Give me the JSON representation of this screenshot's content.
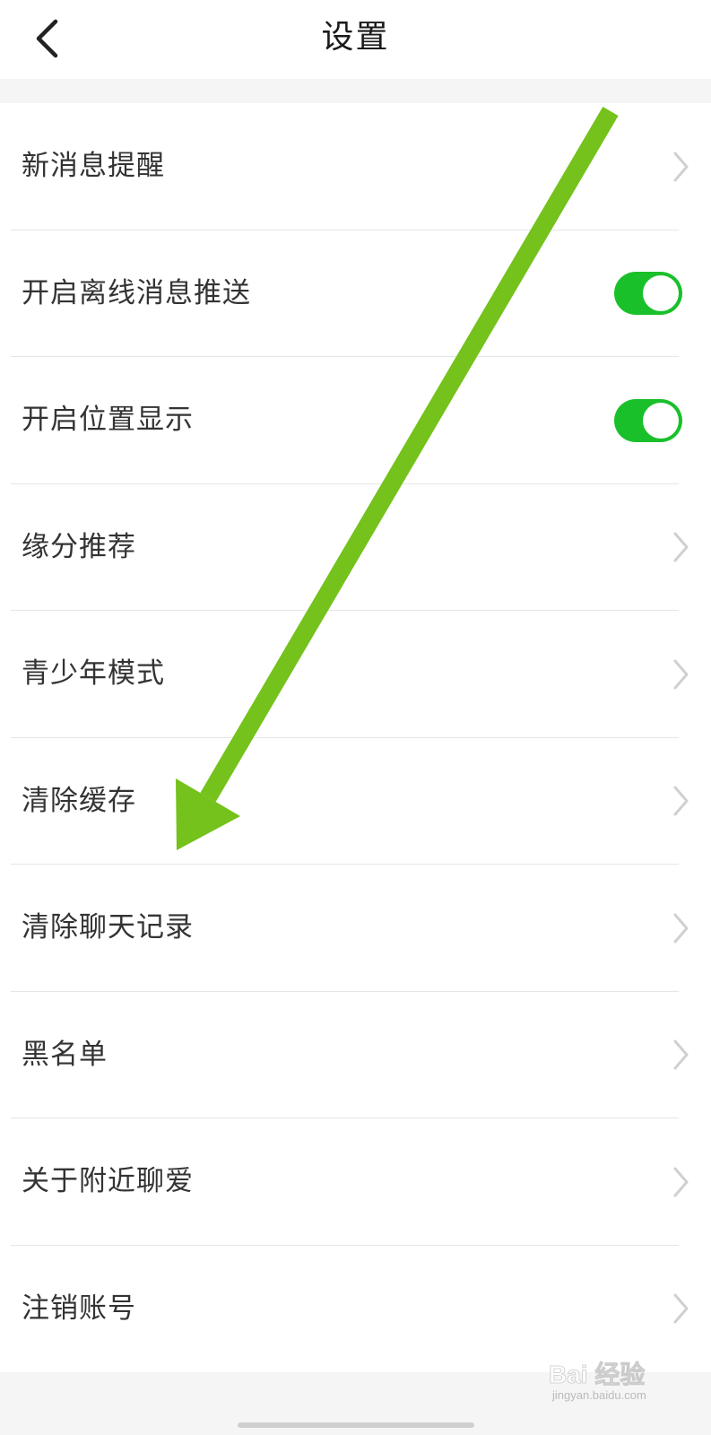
{
  "header": {
    "title": "设置",
    "back_icon": "chevron-left-icon"
  },
  "settings": {
    "items": [
      {
        "label": "新消息提醒",
        "control": "chevron"
      },
      {
        "label": "开启离线消息推送",
        "control": "toggle",
        "toggle_on": true
      },
      {
        "label": "开启位置显示",
        "control": "toggle",
        "toggle_on": true
      },
      {
        "label": "缘分推荐",
        "control": "chevron"
      },
      {
        "label": "青少年模式",
        "control": "chevron"
      },
      {
        "label": "清除缓存",
        "control": "chevron"
      },
      {
        "label": "清除聊天记录",
        "control": "chevron"
      },
      {
        "label": "黑名单",
        "control": "chevron"
      },
      {
        "label": "关于附近聊爱",
        "control": "chevron"
      },
      {
        "label": "注销账号",
        "control": "chevron"
      }
    ]
  },
  "colors": {
    "toggle_on": "#1ac02a",
    "annotation_arrow": "#74c21b",
    "divider": "#e6e6e6",
    "background": "#f5f5f5"
  },
  "watermark": {
    "logo": "Bai 经验",
    "url": "jingyan.baidu.com"
  }
}
